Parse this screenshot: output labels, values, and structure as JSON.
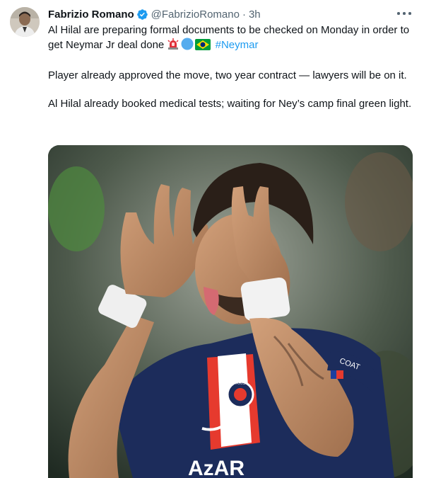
{
  "author": {
    "name": "Fabrizio Romano",
    "handle": "@FabrizioRomano",
    "separator": "·",
    "time": "3h",
    "verified": true
  },
  "tweet": {
    "line1": "Al Hilal are preparing formal documents to be checked on Monday in order to get Neymar Jr deal done",
    "hashtag": "#Neymar",
    "emojis": [
      "siren-emoji",
      "blue-circle-emoji",
      "brazil-flag-emoji"
    ],
    "paragraph2": "Player already approved the move, two year contract — lawyers will be on it.",
    "paragraph3": "Al Hilal already booked medical tests; waiting for Ney’s camp final green light."
  },
  "media": {
    "jersey_text": "AzAR",
    "badge_text": "PARIS",
    "armband_text": "COAT"
  },
  "colors": {
    "text": "#0f1419",
    "secondary": "#536471",
    "link": "#1d9bf0",
    "jersey": "#1c2c5b"
  }
}
